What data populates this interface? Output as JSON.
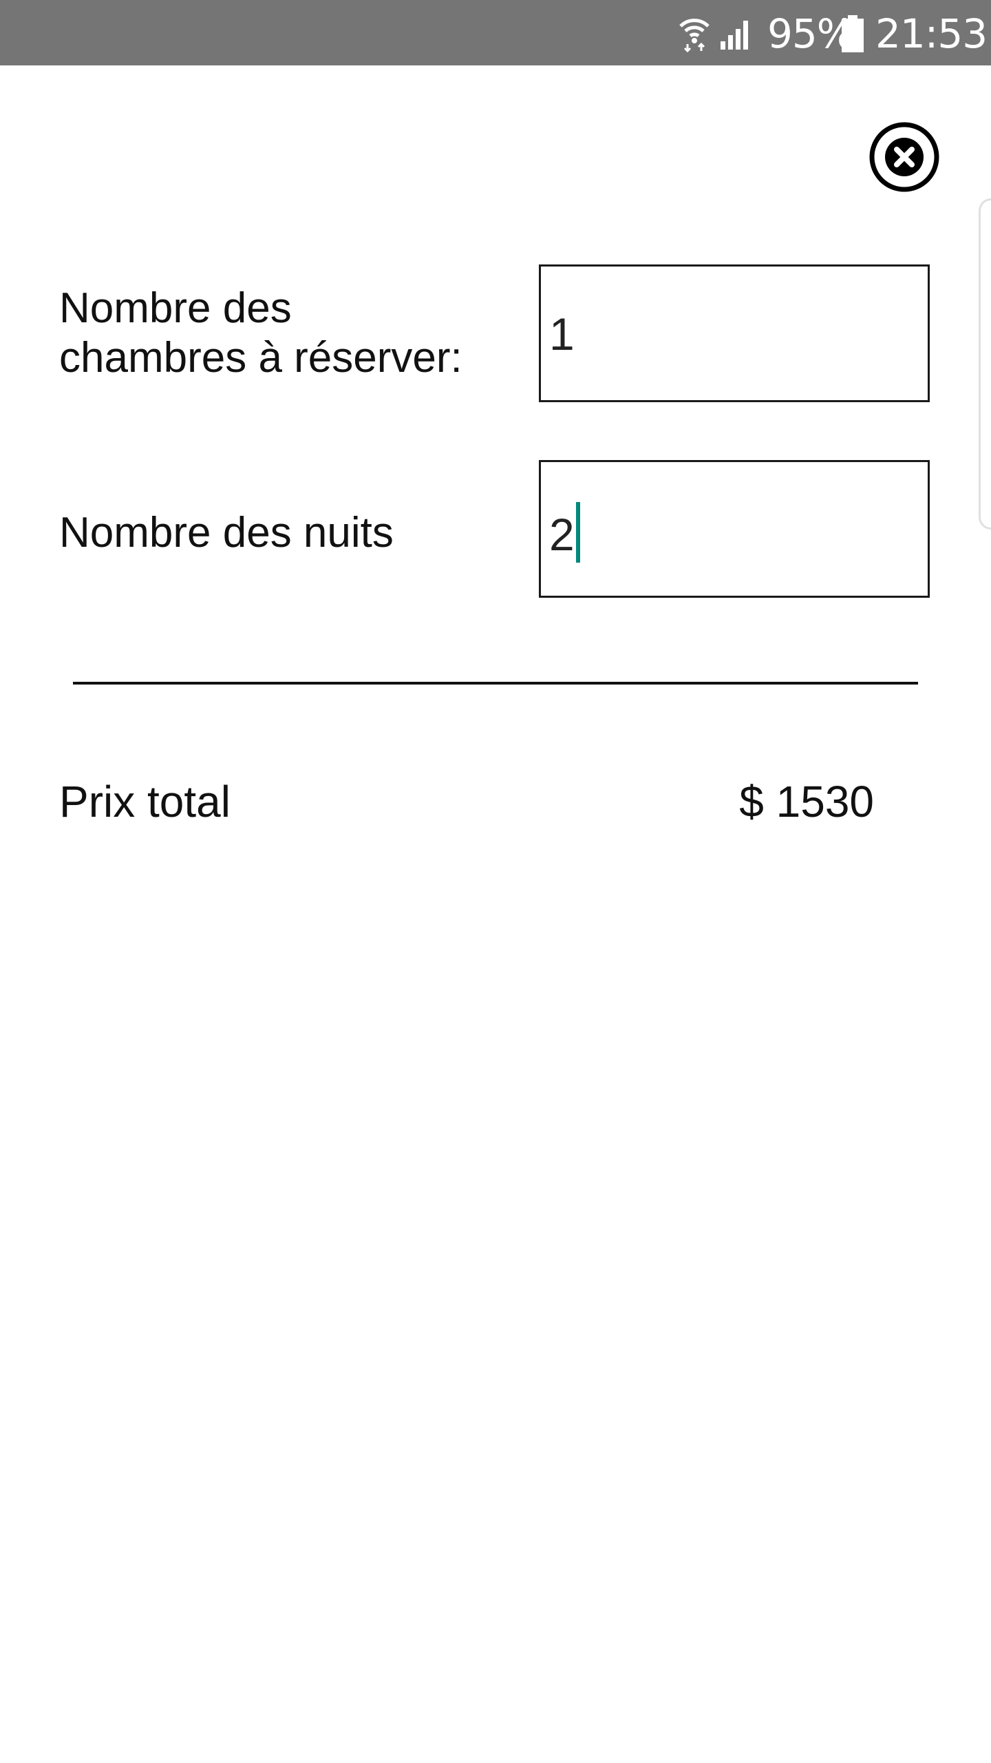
{
  "status_bar": {
    "battery_percent": "95%",
    "time": "21:53",
    "icons": [
      "wifi-icon",
      "signal-icon",
      "battery-icon"
    ]
  },
  "close_icon": "close-icon",
  "form": {
    "rooms_label_line1": "Nombre des",
    "rooms_label_line2": "chambres à réserver:",
    "rooms_value": "1",
    "nights_label": "Nombre des nuits",
    "nights_value": "2"
  },
  "summary": {
    "total_label": "Prix total",
    "total_value": "$ 1530"
  },
  "colors": {
    "status_bar": "#757575",
    "cursor_accent": "#00897b"
  }
}
